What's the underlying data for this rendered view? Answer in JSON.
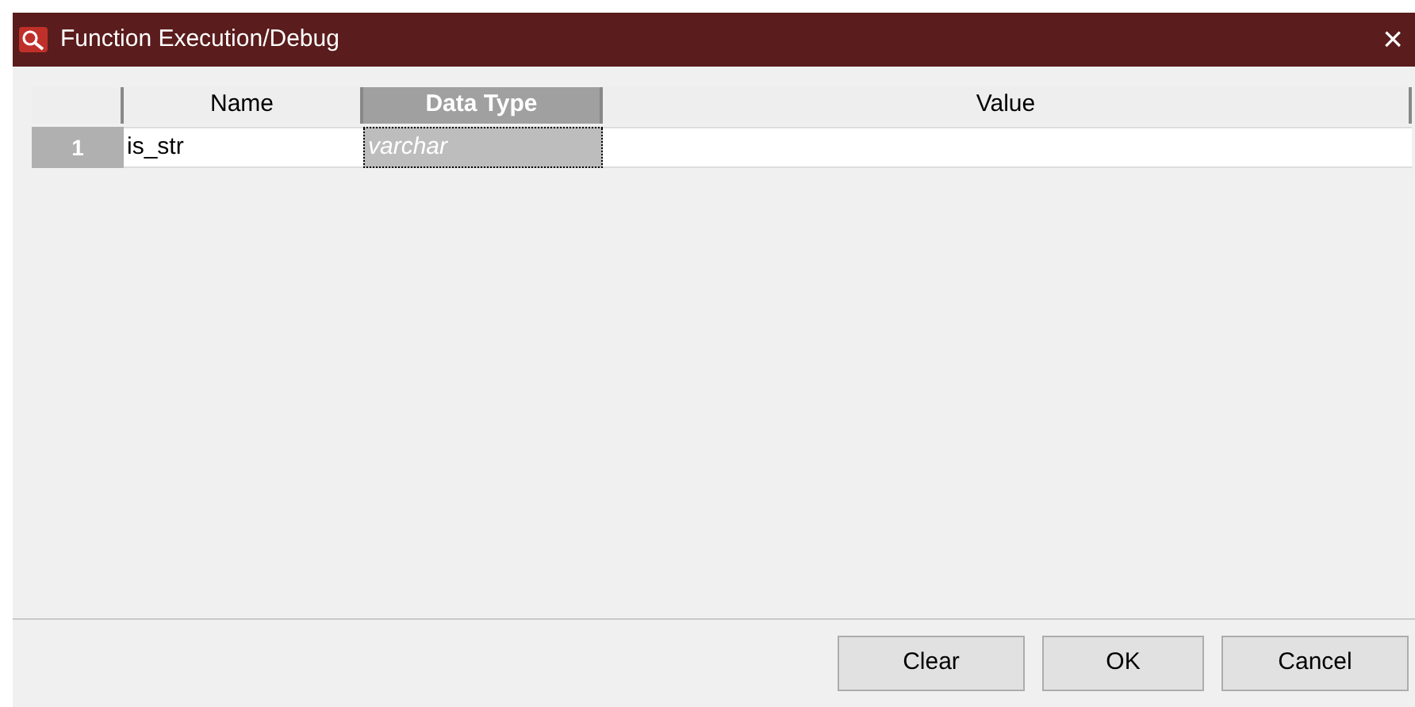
{
  "window": {
    "title": "Function Execution/Debug",
    "close": "×"
  },
  "table": {
    "columns": [
      {
        "selected": false
      },
      {
        "label": "Name",
        "selected": false
      },
      {
        "label": "Data Type",
        "selected": true
      },
      {
        "label": "Value",
        "selected": false
      }
    ],
    "rows": [
      {
        "number": "1",
        "cells": [
          {
            "text": "is_str",
            "selected": false
          },
          {
            "text": "varchar",
            "selected": true
          },
          {
            "selected": false
          }
        ]
      }
    ]
  },
  "buttons": [
    "Clear",
    "OK",
    "Cancel"
  ]
}
